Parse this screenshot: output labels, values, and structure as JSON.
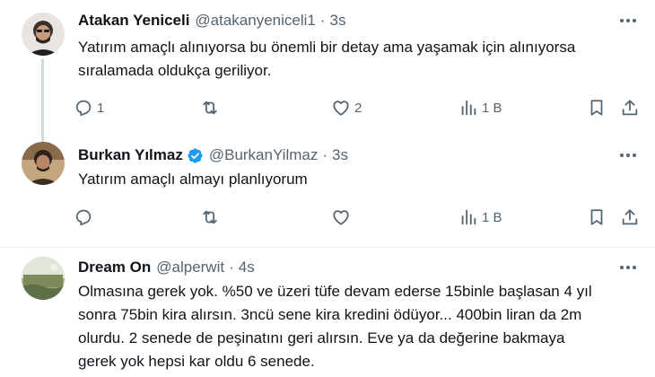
{
  "tweets": [
    {
      "name": "Atakan Yeniceli",
      "handle": "@atakanyeniceli1",
      "time": "3s",
      "text_lines": [
        "Yatırım amaçlı alınıyorsa bu önemli bir detay ama yaşamak için alınıyorsa",
        "sıralamada oldukça geriliyor."
      ],
      "reply_count": "1",
      "retweet_count": "",
      "like_count": "2",
      "view_count": "1 B"
    },
    {
      "name": "Burkan Yılmaz",
      "handle": "@BurkanYilmaz",
      "time": "3s",
      "verified": true,
      "text_lines": [
        "Yatırım amaçlı almayı planlıyorum"
      ],
      "reply_count": "",
      "retweet_count": "",
      "like_count": "",
      "view_count": "1 B"
    },
    {
      "name": "Dream On",
      "handle": "@alperwit",
      "time": "4s",
      "text_lines": [
        "Olmasına gerek yok. %50 ve üzeri tüfe devam ederse  15binle başlasan 4 yıl",
        "sonra 75bin kira alırsın. 3ncü sene kira kredini ödüyor... 400bin liran da 2m",
        "olurdu. 2 senede de peşinatını geri alırsın. Eve ya da değerine bakmaya",
        "gerek yok hepsi kar oldu 6 senede."
      ]
    }
  ],
  "separator": "·",
  "colors": {
    "text": "#0f1419",
    "muted": "#536471",
    "verified": "#1d9bf0",
    "thread_line": "#cfd9de"
  },
  "icons": [
    "more-icon",
    "reply-icon",
    "retweet-icon",
    "like-icon",
    "views-icon",
    "bookmark-icon",
    "share-icon",
    "verified-badge-icon"
  ]
}
